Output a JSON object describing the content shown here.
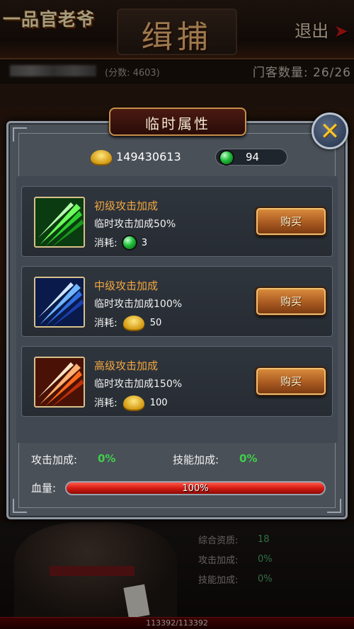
{
  "screen": {
    "logo": "一品官老爷",
    "title": "缉捕",
    "exit_label": "退出",
    "score_text": "(分数: 4603)",
    "guest_count_text": "门客数量: 26/26"
  },
  "background_stats": [
    {
      "label": "综合资质:",
      "value": "18"
    },
    {
      "label": "攻击加成:",
      "value": "0%"
    },
    {
      "label": "技能加成:",
      "value": "0%"
    }
  ],
  "hp_footer_text": "113392/113392",
  "popup": {
    "title": "临时属性",
    "close_icon": "close-x-icon",
    "gold_amount": "149430613",
    "gem_amount": "94",
    "cost_label": "消耗:",
    "buy_label": "购买",
    "items": [
      {
        "name": "初级攻击加成",
        "desc": "临时攻击加成50%",
        "cost_currency": "gem",
        "cost": "3",
        "icon": "green-slash-icon"
      },
      {
        "name": "中级攻击加成",
        "desc": "临时攻击加成100%",
        "cost_currency": "gold",
        "cost": "50",
        "icon": "blue-slash-icon"
      },
      {
        "name": "高级攻击加成",
        "desc": "临时攻击加成150%",
        "cost_currency": "gold",
        "cost": "100",
        "icon": "orange-slash-icon"
      }
    ],
    "attack_bonus_label": "攻击加成:",
    "attack_bonus_value": "0%",
    "skill_bonus_label": "技能加成:",
    "skill_bonus_value": "0%",
    "hp_label": "血量:",
    "hp_text": "100%",
    "hp_fraction": 1.0
  },
  "colors": {
    "accent_orange": "#f1a640",
    "bonus_green": "#3ed04a",
    "hp_red": "#d41b12"
  }
}
